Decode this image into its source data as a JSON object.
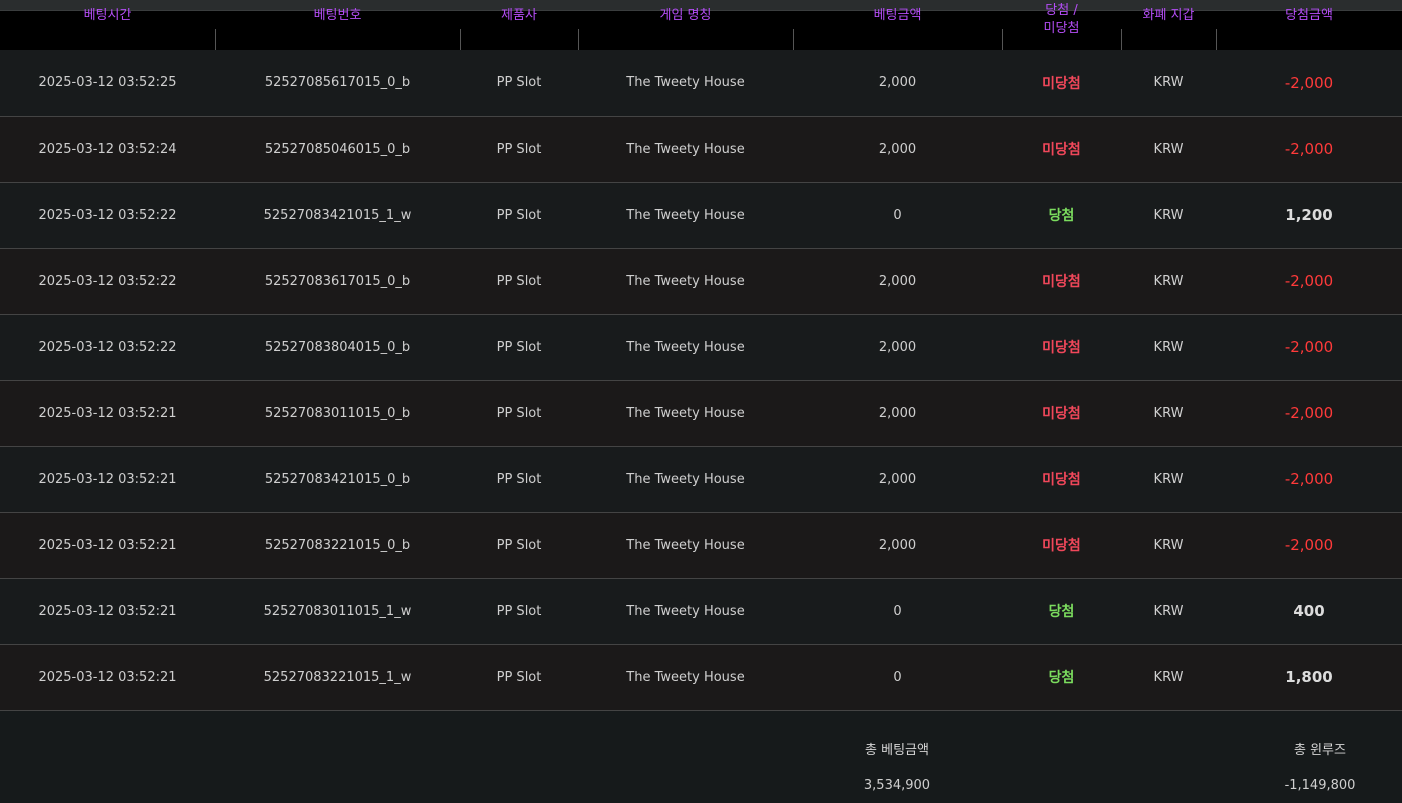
{
  "headers": {
    "bet_time": "베팅시간",
    "bet_number": "베팅번호",
    "provider": "제품사",
    "game_name": "게임 명칭",
    "bet_amount": "베팅금액",
    "result_line1": "당첨 /",
    "result_line2": "미당첨",
    "currency": "화폐 지갑",
    "win_amount": "당첨금액"
  },
  "rows": [
    {
      "time": "2025-03-12 03:52:25",
      "id": "52527085617015_0_b",
      "provider": "PP Slot",
      "game": "The Tweety House",
      "bet": "2,000",
      "result": "미당첨",
      "currency": "KRW",
      "amount": "-2,000"
    },
    {
      "time": "2025-03-12 03:52:24",
      "id": "52527085046015_0_b",
      "provider": "PP Slot",
      "game": "The Tweety House",
      "bet": "2,000",
      "result": "미당첨",
      "currency": "KRW",
      "amount": "-2,000"
    },
    {
      "time": "2025-03-12 03:52:22",
      "id": "52527083421015_1_w",
      "provider": "PP Slot",
      "game": "The Tweety House",
      "bet": "0",
      "result": "당첨",
      "currency": "KRW",
      "amount": "1,200"
    },
    {
      "time": "2025-03-12 03:52:22",
      "id": "52527083617015_0_b",
      "provider": "PP Slot",
      "game": "The Tweety House",
      "bet": "2,000",
      "result": "미당첨",
      "currency": "KRW",
      "amount": "-2,000"
    },
    {
      "time": "2025-03-12 03:52:22",
      "id": "52527083804015_0_b",
      "provider": "PP Slot",
      "game": "The Tweety House",
      "bet": "2,000",
      "result": "미당첨",
      "currency": "KRW",
      "amount": "-2,000"
    },
    {
      "time": "2025-03-12 03:52:21",
      "id": "52527083011015_0_b",
      "provider": "PP Slot",
      "game": "The Tweety House",
      "bet": "2,000",
      "result": "미당첨",
      "currency": "KRW",
      "amount": "-2,000"
    },
    {
      "time": "2025-03-12 03:52:21",
      "id": "52527083421015_0_b",
      "provider": "PP Slot",
      "game": "The Tweety House",
      "bet": "2,000",
      "result": "미당첨",
      "currency": "KRW",
      "amount": "-2,000"
    },
    {
      "time": "2025-03-12 03:52:21",
      "id": "52527083221015_0_b",
      "provider": "PP Slot",
      "game": "The Tweety House",
      "bet": "2,000",
      "result": "미당첨",
      "currency": "KRW",
      "amount": "-2,000"
    },
    {
      "time": "2025-03-12 03:52:21",
      "id": "52527083011015_1_w",
      "provider": "PP Slot",
      "game": "The Tweety House",
      "bet": "0",
      "result": "당첨",
      "currency": "KRW",
      "amount": "400"
    },
    {
      "time": "2025-03-12 03:52:21",
      "id": "52527083221015_1_w",
      "provider": "PP Slot",
      "game": "The Tweety House",
      "bet": "0",
      "result": "당첨",
      "currency": "KRW",
      "amount": "1,800"
    }
  ],
  "footer": {
    "total_bet_label": "총 베팅금액",
    "total_bet_value": "3,534,900",
    "total_winloss_label": "총 윈루즈",
    "total_winloss_value": "-1,149,800"
  },
  "colors": {
    "header_text": "#b44df5",
    "lose": "#f0475a",
    "win": "#7bdc5e",
    "negative_amount": "#ff3a3a"
  }
}
